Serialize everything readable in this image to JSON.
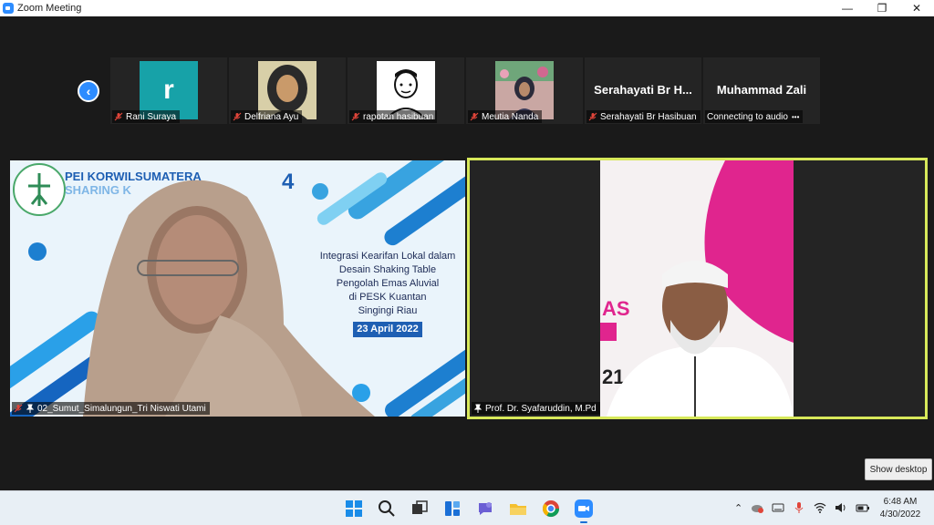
{
  "window": {
    "title": "Zoom Meeting",
    "controls": [
      "—",
      "❐",
      "✕"
    ]
  },
  "gallery": {
    "nav_prev_symbol": "‹",
    "participants": [
      {
        "name": "Rani Suraya",
        "avatar_letter": "r",
        "muted": true
      },
      {
        "name": "Delfriana Ayu",
        "muted": true
      },
      {
        "name": "rapotan hasibuan",
        "muted": true
      },
      {
        "name": "Meutia Nanda",
        "muted": true
      },
      {
        "name": "Serahayati Br Hasibuan",
        "display_name": "Serahayati  Br  H...",
        "muted": true
      },
      {
        "name": "Connecting to audio",
        "display_name": "Muhammad Zali",
        "status_dots": "•••"
      }
    ]
  },
  "main_video_left": {
    "name": "02_Sumut_Simalungun_Tri Niswati Utami",
    "muted": true,
    "pinned": true,
    "slide": {
      "header": "PEI KORWILSUMATERA",
      "subheader": "SHARING K",
      "number": "4",
      "lines": [
        "Integrasi Kearifan Lokal dalam",
        "Desain Shaking Table",
        "Pengolah Emas Aluvial",
        "di PESK Kuantan",
        "Singingi Riau"
      ],
      "date": "23 April 2022"
    }
  },
  "main_video_right": {
    "name": "Prof. Dr. Syafaruddin, M.Pd",
    "pinned": true,
    "bg_text": [
      "AS",
      "21"
    ]
  },
  "show_desktop_label": "Show desktop",
  "taskbar": {
    "apps": [
      "windows-start",
      "search",
      "task-view",
      "widgets",
      "teams-chat",
      "file-explorer",
      "chrome",
      "zoom"
    ],
    "time": "6:48 AM",
    "date": "4/30/2022"
  },
  "colors": {
    "zoom_blue": "#2D8CFF",
    "active_speaker_border": "#d7e85a",
    "mute_red": "#e0453a",
    "slide_accent": "#1e5fb3",
    "pink_slide": "#e0258e"
  }
}
